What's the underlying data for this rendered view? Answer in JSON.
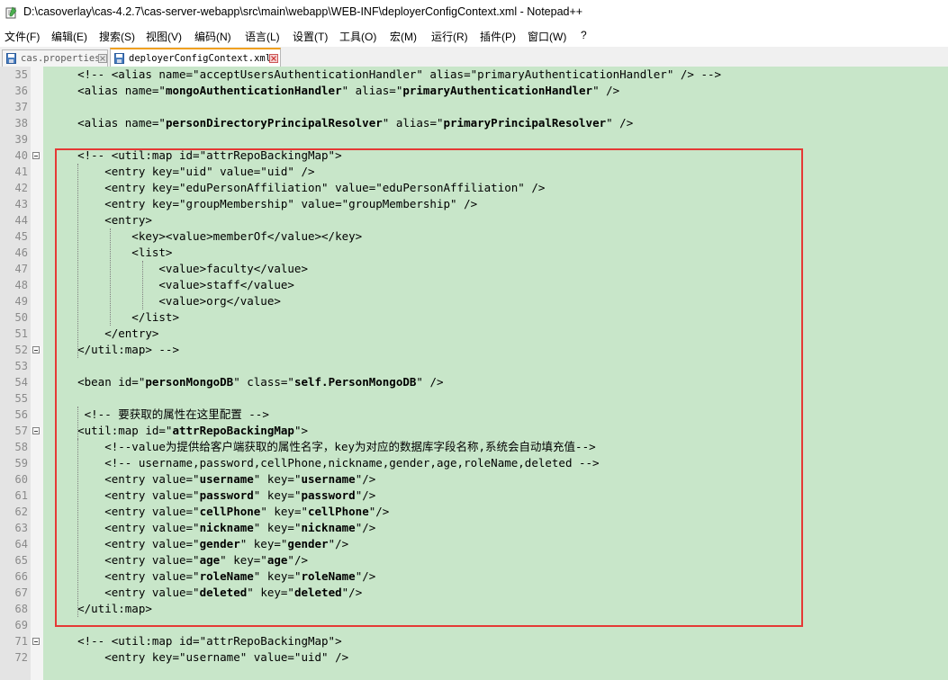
{
  "window": {
    "title": "D:\\casoverlay\\cas-4.2.7\\cas-server-webapp\\src\\main\\webapp\\WEB-INF\\deployerConfigContext.xml - Notepad++"
  },
  "menu": [
    "文件(F)",
    "编辑(E)",
    "搜索(S)",
    "视图(V)",
    "编码(N)",
    "语言(L)",
    "设置(T)",
    "工具(O)",
    "宏(M)",
    "运行(R)",
    "插件(P)",
    "窗口(W)",
    "?"
  ],
  "tabs": [
    {
      "label": "cas.properties",
      "active": false
    },
    {
      "label": "deployerConfigContext.xml",
      "active": true
    }
  ],
  "colors": {
    "editor_bg": "#c8e6c9",
    "highlight": "#e53935",
    "active_tab_accent": "#f0a020"
  },
  "lines": [
    {
      "n": "35",
      "t": "    <!-- <alias name=\"acceptUsersAuthenticationHandler\" alias=\"primaryAuthenticationHandler\" /> -->"
    },
    {
      "n": "36",
      "t": "    <alias name=\"**mongoAuthenticationHandler**\" alias=\"**primaryAuthenticationHandler**\" />"
    },
    {
      "n": "37",
      "t": ""
    },
    {
      "n": "38",
      "t": "    <alias name=\"**personDirectoryPrincipalResolver**\" alias=\"**primaryPrincipalResolver**\" />"
    },
    {
      "n": "39",
      "t": ""
    },
    {
      "n": "40",
      "t": "    <!-- <util:map id=\"attrRepoBackingMap\">",
      "fold": true
    },
    {
      "n": "41",
      "t": "        <entry key=\"uid\" value=\"uid\" />"
    },
    {
      "n": "42",
      "t": "        <entry key=\"eduPersonAffiliation\" value=\"eduPersonAffiliation\" />"
    },
    {
      "n": "43",
      "t": "        <entry key=\"groupMembership\" value=\"groupMembership\" />"
    },
    {
      "n": "44",
      "t": "        <entry>"
    },
    {
      "n": "45",
      "t": "            <key><value>memberOf</value></key>"
    },
    {
      "n": "46",
      "t": "            <list>"
    },
    {
      "n": "47",
      "t": "                <value>faculty</value>"
    },
    {
      "n": "48",
      "t": "                <value>staff</value>"
    },
    {
      "n": "49",
      "t": "                <value>org</value>"
    },
    {
      "n": "50",
      "t": "            </list>"
    },
    {
      "n": "51",
      "t": "        </entry>"
    },
    {
      "n": "52",
      "t": "    </util:map> -->",
      "fold": true
    },
    {
      "n": "53",
      "t": ""
    },
    {
      "n": "54",
      "t": "    <bean id=\"**personMongoDB**\" class=\"**self.PersonMongoDB**\" />"
    },
    {
      "n": "55",
      "t": ""
    },
    {
      "n": "56",
      "t": "     <!-- 要获取的属性在这里配置 -->"
    },
    {
      "n": "57",
      "t": "    <util:map id=\"**attrRepoBackingMap**\">",
      "fold": true
    },
    {
      "n": "58",
      "t": "        <!--value为提供给客户端获取的属性名字，key为对应的数据库字段名称,系统会自动填充值-->"
    },
    {
      "n": "59",
      "t": "        <!-- username,password,cellPhone,nickname,gender,age,roleName,deleted -->"
    },
    {
      "n": "60",
      "t": "        <entry value=\"**username**\" key=\"**username**\"/>"
    },
    {
      "n": "61",
      "t": "        <entry value=\"**password**\" key=\"**password**\"/>"
    },
    {
      "n": "62",
      "t": "        <entry value=\"**cellPhone**\" key=\"**cellPhone**\"/>"
    },
    {
      "n": "63",
      "t": "        <entry value=\"**nickname**\" key=\"**nickname**\"/>"
    },
    {
      "n": "64",
      "t": "        <entry value=\"**gender**\" key=\"**gender**\"/>"
    },
    {
      "n": "65",
      "t": "        <entry value=\"**age**\" key=\"**age**\"/>"
    },
    {
      "n": "66",
      "t": "        <entry value=\"**roleName**\" key=\"**roleName**\"/>"
    },
    {
      "n": "67",
      "t": "        <entry value=\"**deleted**\" key=\"**deleted**\"/>"
    },
    {
      "n": "68",
      "t": "    </util:map>"
    },
    {
      "n": "69",
      "t": ""
    },
    {
      "n": "71",
      "t": "    <!-- <util:map id=\"attrRepoBackingMap\">",
      "fold": true
    },
    {
      "n": "72",
      "t": "        <entry key=\"username\" value=\"uid\" />"
    }
  ]
}
